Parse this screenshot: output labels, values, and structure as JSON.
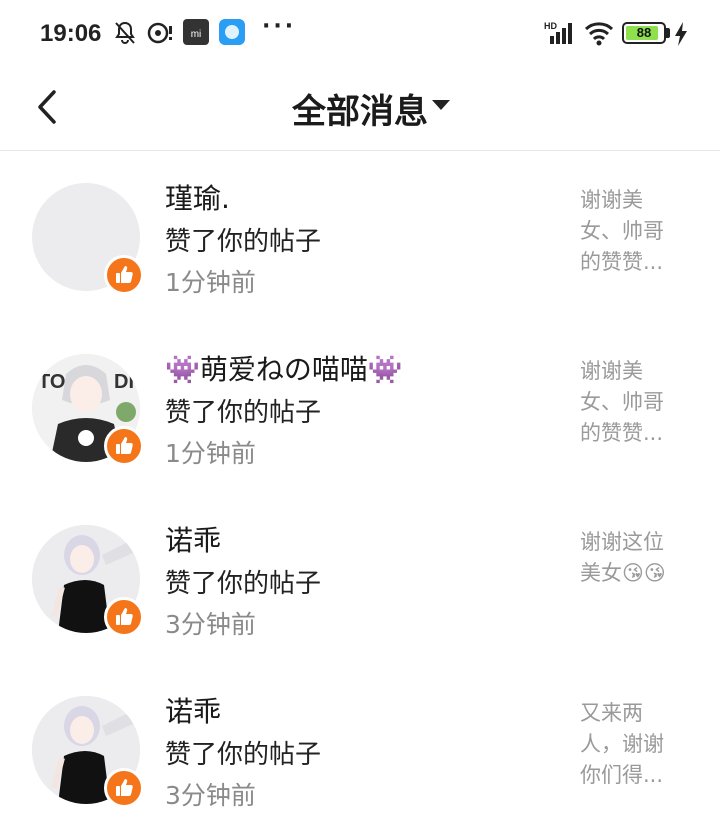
{
  "status_bar": {
    "time": "19:06",
    "battery": "88",
    "battery_level": 0.88,
    "icons": [
      "bell-off-icon",
      "record-icon",
      "mi-store-icon",
      "app-icon",
      "more-dots-icon",
      "hd-signal-icon",
      "wifi-icon",
      "charging-icon"
    ]
  },
  "header": {
    "title": "全部消息",
    "back_icon": "chevron-left-icon",
    "dropdown_icon": "caret-down-icon"
  },
  "colors": {
    "like_badge": "#f5761a",
    "secondary_text": "#8a8a8a",
    "preview_text": "#9a9a9a"
  },
  "messages": [
    {
      "name": "瑾瑜.",
      "action": "赞了你的帖子",
      "time": "1分钟前",
      "preview_lines": [
        "谢谢美",
        "女、帅哥",
        "的赞赞..."
      ],
      "avatar": "blank"
    },
    {
      "name": "👾萌爱ねの喵喵👾",
      "action": "赞了你的帖子",
      "time": "1分钟前",
      "preview_lines": [
        "谢谢美",
        "女、帅哥",
        "的赞赞..."
      ],
      "avatar": "anime-girl-white-hair"
    },
    {
      "name": "诺乖",
      "action": "赞了你的帖子",
      "time": "3分钟前",
      "preview_lines": [
        "谢谢这位",
        "美女😘😘"
      ],
      "avatar": "anime-girl-black-dress"
    },
    {
      "name": "诺乖",
      "action": "赞了你的帖子",
      "time": "3分钟前",
      "preview_lines": [
        "又来两",
        "人，谢谢",
        "你们得..."
      ],
      "avatar": "anime-girl-black-dress"
    }
  ]
}
